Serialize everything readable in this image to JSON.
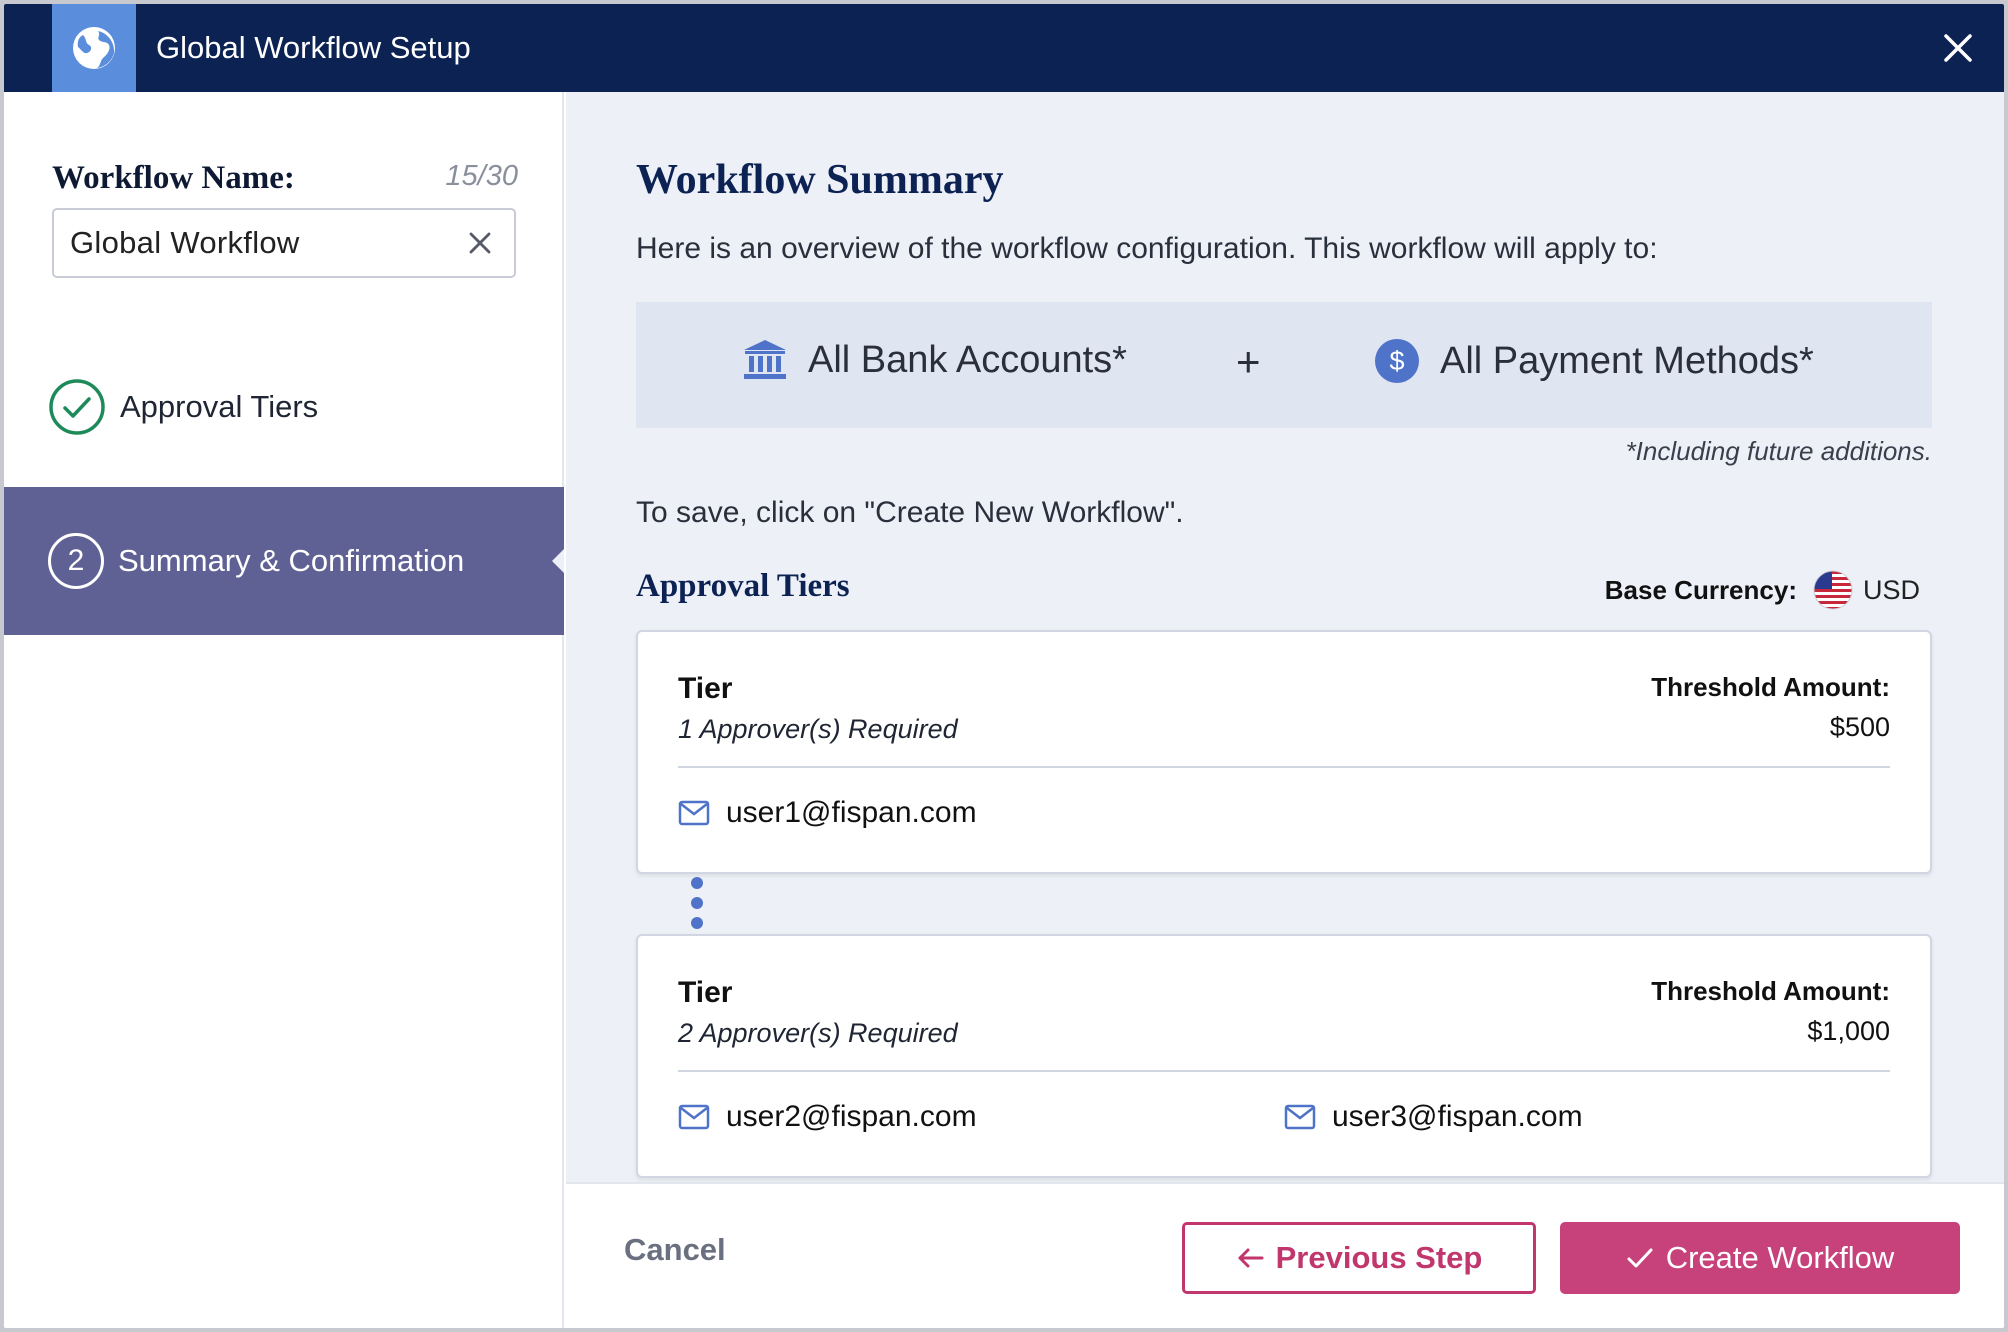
{
  "header": {
    "title": "Global Workflow Setup"
  },
  "sidebar": {
    "name_label": "Workflow Name:",
    "name_count": "15/30",
    "name_value": "Global Workflow",
    "steps": [
      {
        "label": "Approval Tiers",
        "state": "complete"
      },
      {
        "number": "2",
        "label": "Summary & Confirmation",
        "state": "active"
      }
    ]
  },
  "main": {
    "title": "Workflow Summary",
    "description": "Here is an overview of the workflow configuration. This workflow will apply to:",
    "applies": {
      "bank": "All Bank Accounts*",
      "plus": "+",
      "payment": "All Payment Methods*",
      "note": "*Including future additions."
    },
    "save_note": "To save, click on \"Create New Workflow\".",
    "tiers_title": "Approval Tiers",
    "currency": {
      "label": "Base Currency:",
      "value": "USD"
    },
    "tiers": [
      {
        "name": "Tier",
        "requirement": "1 Approver(s) Required",
        "threshold_label": "Threshold Amount:",
        "threshold_value": "$500",
        "approvers": [
          "user1@fispan.com"
        ]
      },
      {
        "name": "Tier",
        "requirement": "2 Approver(s) Required",
        "threshold_label": "Threshold Amount:",
        "threshold_value": "$1,000",
        "approvers": [
          "user2@fispan.com",
          "user3@fispan.com"
        ]
      }
    ]
  },
  "footer": {
    "cancel": "Cancel",
    "previous": "Previous Step",
    "create": "Create Workflow"
  },
  "colors": {
    "header_bg": "#0b2253",
    "accent_blue": "#5b8ddd",
    "active_step_bg": "#5f6194",
    "primary_pink": "#c7417b",
    "success_green": "#1e8a5a"
  }
}
